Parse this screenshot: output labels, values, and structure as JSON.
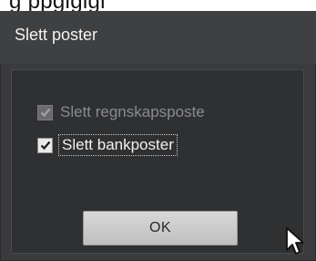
{
  "background": {
    "partial_text": "g ppgigigi"
  },
  "dialog": {
    "title": "Slett poster",
    "options": [
      {
        "label": "Slett regnskapsposte",
        "checked": true,
        "enabled": false
      },
      {
        "label": "Slett bankposter",
        "checked": true,
        "enabled": true
      }
    ],
    "ok_label": "OK"
  },
  "colors": {
    "dialog_bg": "#3a3b3d",
    "content_bg": "#2f3032",
    "button_bg": "#cfcfcf",
    "disabled_text": "#8a8b8d",
    "enabled_text": "#f1f1f1"
  },
  "icons": {
    "checkmark": "checkmark-icon",
    "cursor": "mouse-pointer-icon"
  }
}
